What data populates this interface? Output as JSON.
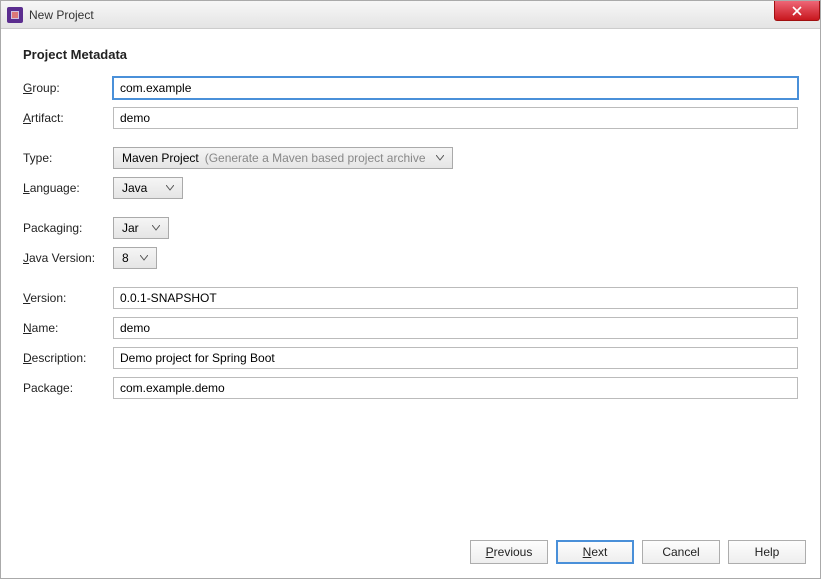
{
  "window": {
    "title": "New Project"
  },
  "heading": "Project Metadata",
  "labels": {
    "group": "Group:",
    "group_u": "G",
    "artifact": "Artifact:",
    "artifact_u": "A",
    "type": "Type:",
    "language": "Language:",
    "language_u": "L",
    "packaging": "Packaging:",
    "java_version": "Java Version:",
    "java_version_u": "J",
    "version": "Version:",
    "version_u": "V",
    "name": "Name:",
    "name_u": "N",
    "description": "Description:",
    "description_u": "D",
    "package": "Package:",
    "package_u": "P"
  },
  "fields": {
    "group": "com.example",
    "artifact": "demo",
    "type_value": "Maven Project",
    "type_hint": "(Generate a Maven based project archive",
    "language": "Java",
    "packaging": "Jar",
    "java_version": "8",
    "version": "0.0.1-SNAPSHOT",
    "name": "demo",
    "description": "Demo project for Spring Boot",
    "package": "com.example.demo"
  },
  "buttons": {
    "previous": "Previous",
    "previous_u": "P",
    "next": "Next",
    "next_u": "N",
    "cancel": "Cancel",
    "help": "Help"
  }
}
